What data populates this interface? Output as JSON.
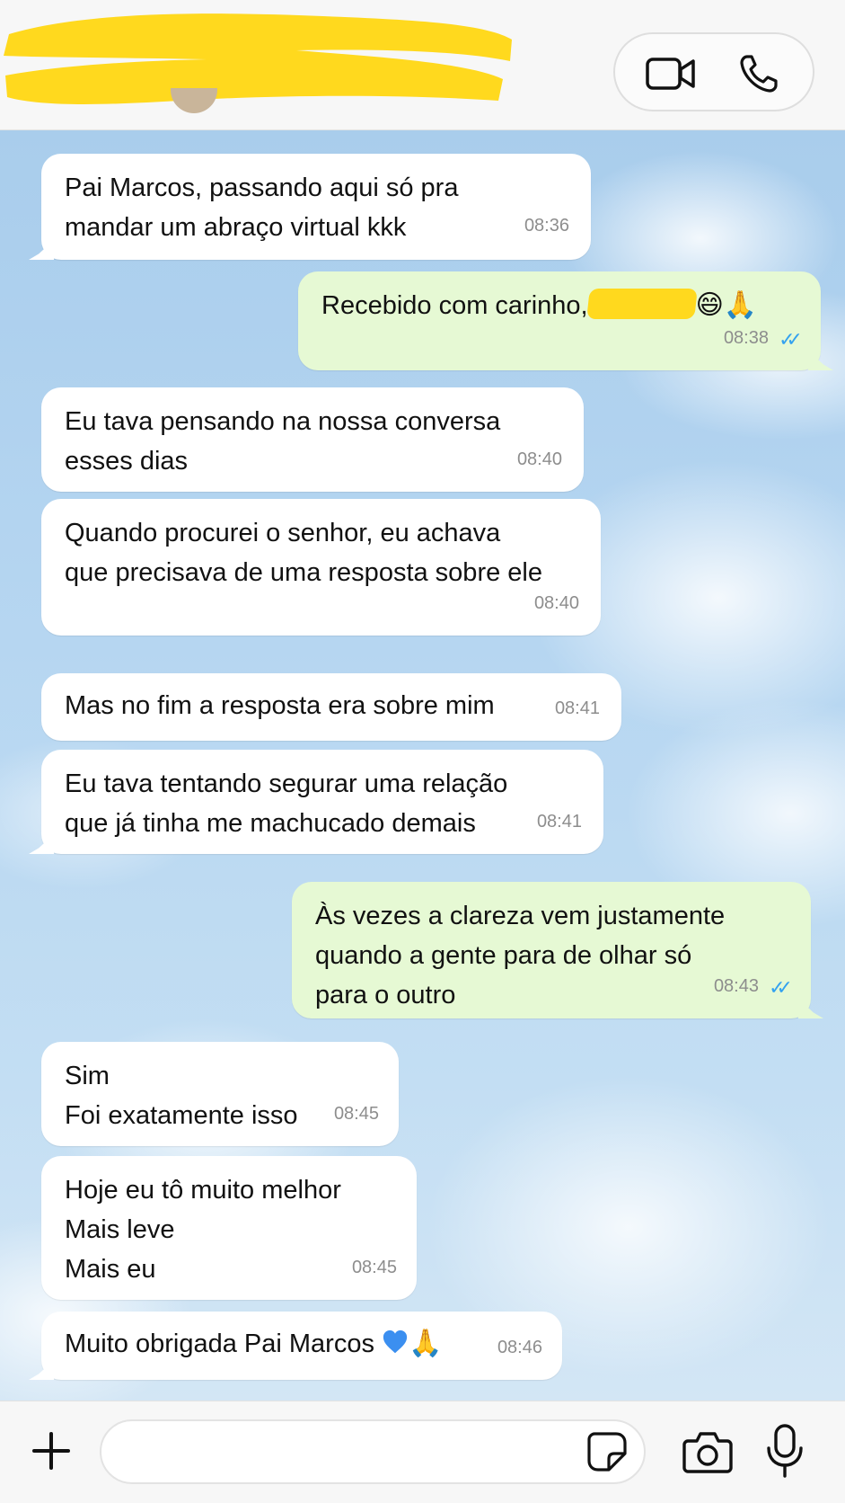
{
  "header": {
    "contact_name_redacted": true,
    "video_call_icon": "video-camera-icon",
    "voice_call_icon": "phone-icon"
  },
  "messages": [
    {
      "dir": "in",
      "lines": [
        "Pai Marcos, passando aqui só pra",
        "mandar um abraço virtual kkk"
      ],
      "time": "08:36"
    },
    {
      "dir": "out",
      "text": "Recebido com carinho,",
      "emoji": "😄🙏",
      "time": "08:38",
      "read": true
    },
    {
      "dir": "in",
      "lines": [
        "Eu tava pensando na nossa conversa",
        "esses dias"
      ],
      "time": "08:40"
    },
    {
      "dir": "in",
      "lines": [
        "Quando procurei o senhor, eu achava",
        "que precisava de uma resposta sobre ele"
      ],
      "time": "08:40"
    },
    {
      "dir": "in",
      "lines": [
        "Mas no fim a resposta era sobre mim"
      ],
      "time": "08:41"
    },
    {
      "dir": "in",
      "lines": [
        "Eu tava tentando segurar uma relação",
        "que já tinha me machucado demais"
      ],
      "time": "08:41"
    },
    {
      "dir": "out",
      "lines": [
        "Às vezes a clareza vem justamente",
        "quando a gente para de olhar só",
        "para o outro"
      ],
      "time": "08:43",
      "read": true
    },
    {
      "dir": "in",
      "lines": [
        "Sim",
        "Foi exatamente isso"
      ],
      "time": "08:45"
    },
    {
      "dir": "in",
      "lines": [
        "Hoje eu tô muito melhor",
        "Mais leve",
        "Mais eu"
      ],
      "time": "08:45"
    },
    {
      "dir": "in",
      "text": "Muito obrigada Pai Marcos",
      "emoji": "🙏",
      "time": "08:46"
    }
  ],
  "footer": {
    "input_value": "",
    "plus_icon": "plus-icon",
    "sticker_icon": "sticker-icon",
    "camera_icon": "camera-icon",
    "mic_icon": "microphone-icon"
  },
  "colors": {
    "incoming_bubble": "#ffffff",
    "outgoing_bubble": "#e6f9d4",
    "read_ticks": "#34a2ef",
    "redaction": "#ffd91e"
  }
}
